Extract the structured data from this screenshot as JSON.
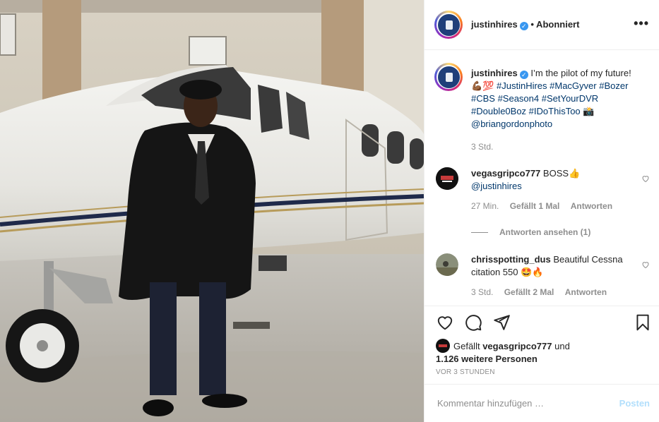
{
  "post": {
    "author": "justinhires",
    "follow_state": "• Abonniert",
    "more_icon": "more-options-icon"
  },
  "caption": {
    "username": "justinhires",
    "text_plain": "I’m the pilot of my future!💪🏾💯",
    "hashtags": "#JustinHires #MacGyver #Bozer #CBS #Season4 #SetYourDVR #Double0Boz #IDoThisToo",
    "emoji_after": "📸",
    "mention": "@briangordonphoto",
    "time": "3 Std."
  },
  "comments": [
    {
      "username": "vegasgripco777",
      "text": "BOSS👍",
      "mention": "@justinhires",
      "time": "27 Min.",
      "likes": "Gefällt 1 Mal",
      "reply": "Antworten"
    },
    {
      "username": "chrisspotting_dus",
      "text": "Beautiful Cessna citation 550 🤩🔥",
      "time": "3 Std.",
      "likes": "Gefällt 2 Mal",
      "reply": "Antworten"
    }
  ],
  "view_replies": "Antworten ansehen (1)",
  "likes": {
    "prefix": "Gefällt",
    "user": "vegasgripco777",
    "joiner": "und",
    "others": "1.126 weitere Personen"
  },
  "timestamp": "VOR 3 STUNDEN",
  "comment_input": {
    "placeholder": "Kommentar hinzufügen …",
    "post_label": "Posten"
  },
  "colors": {
    "link": "#00376b",
    "muted": "#8e8e8e",
    "verified": "#3897f0",
    "post_disabled": "#b2dffc"
  }
}
